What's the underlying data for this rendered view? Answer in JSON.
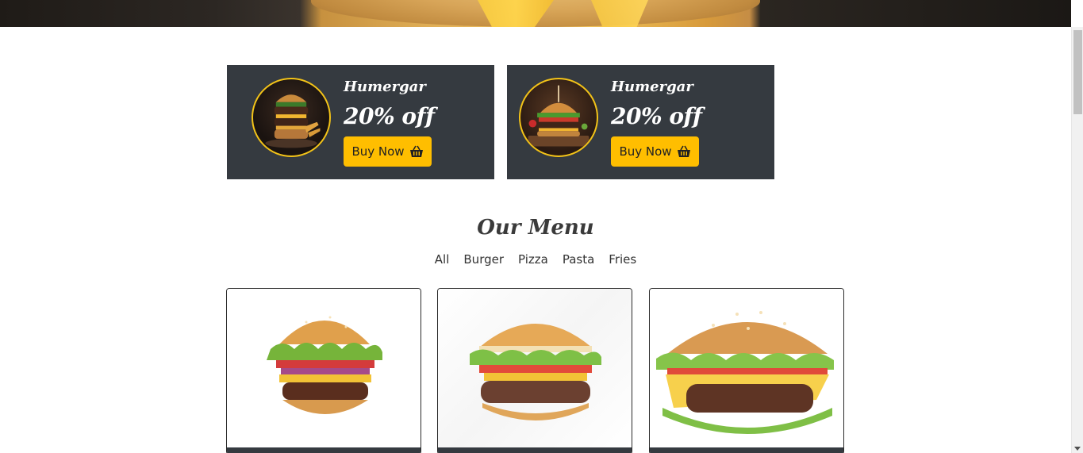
{
  "offers": [
    {
      "title": "Humergar",
      "discount": "20% off",
      "button_label": "Buy Now",
      "icon": "basket-icon"
    },
    {
      "title": "Humergar",
      "discount": "20% off",
      "button_label": "Buy Now",
      "icon": "basket-icon"
    }
  ],
  "menu": {
    "heading": "Our Menu",
    "filters": [
      "All",
      "Burger",
      "Pizza",
      "Pasta",
      "Fries"
    ]
  },
  "colors": {
    "accent": "#ffbe00",
    "dark_panel": "#353a40",
    "ring": "#f3c318"
  }
}
